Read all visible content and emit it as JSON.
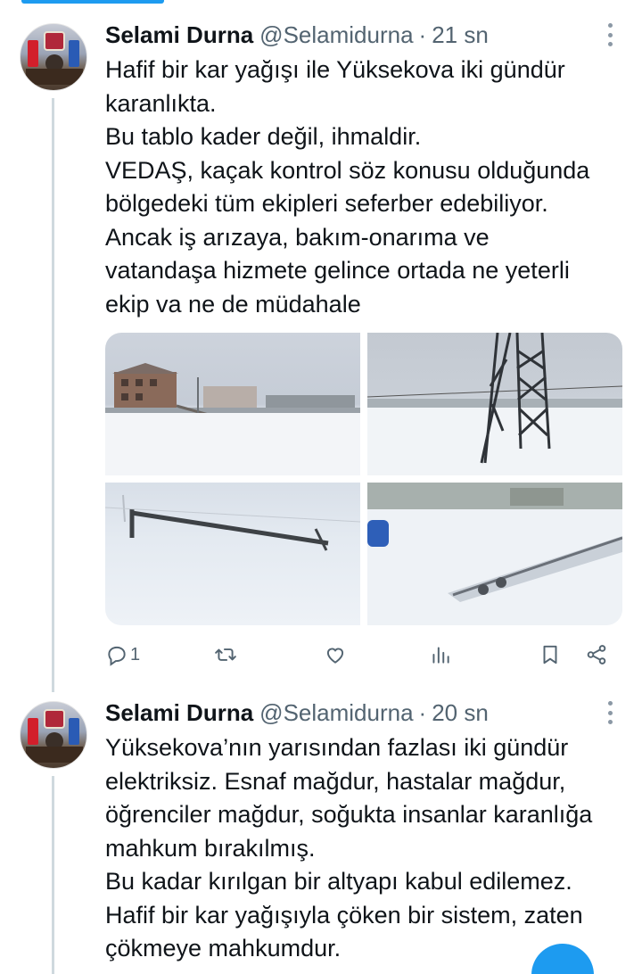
{
  "tweets": [
    {
      "name": "Selami Durna",
      "handle": "@Selamidurna",
      "separator": "·",
      "time": "21 sn",
      "lines": [
        "Hafif bir kar yağışı ile Yüksekova iki gündür",
        "karanlıkta.",
        "Bu tablo kader değil, ihmaldir.",
        "VEDAŞ, kaçak kontrol söz konusu olduğunda",
        "bölgedeki tüm ekipleri seferber edebiliyor.",
        "Ancak iş arızaya, bakım-onarıma ve",
        "vatandaşa hizmete gelince ortada ne yeterli",
        "ekip va ne de müdahale"
      ],
      "actions": {
        "reply_icon": "reply-icon",
        "reply_count": "1",
        "retweet_icon": "retweet-icon",
        "like_icon": "heart-icon",
        "views_icon": "views-icon",
        "bookmark_icon": "bookmark-icon",
        "share_icon": "share-icon"
      }
    },
    {
      "name": "Selami Durna",
      "handle": "@Selamidurna",
      "separator": "·",
      "time": "20 sn",
      "lines": [
        "Yüksekova’nın yarısından fazlası iki gündür",
        "elektriksiz. Esnaf mağdur, hastalar mağdur,",
        "öğrenciler mağdur, soğukta insanlar karanlığa",
        "mahkum bırakılmış.",
        "Bu kadar kırılgan bir altyapı kabul edilemez.",
        "Hafif bir kar yağışıyla çöken bir sistem, zaten",
        "çökmeye mahkumdur."
      ]
    }
  ],
  "colors": {
    "accent": "#1d9bf0",
    "text_primary": "#0f1419",
    "text_secondary": "#536471",
    "thread_line": "#cfd9de"
  }
}
